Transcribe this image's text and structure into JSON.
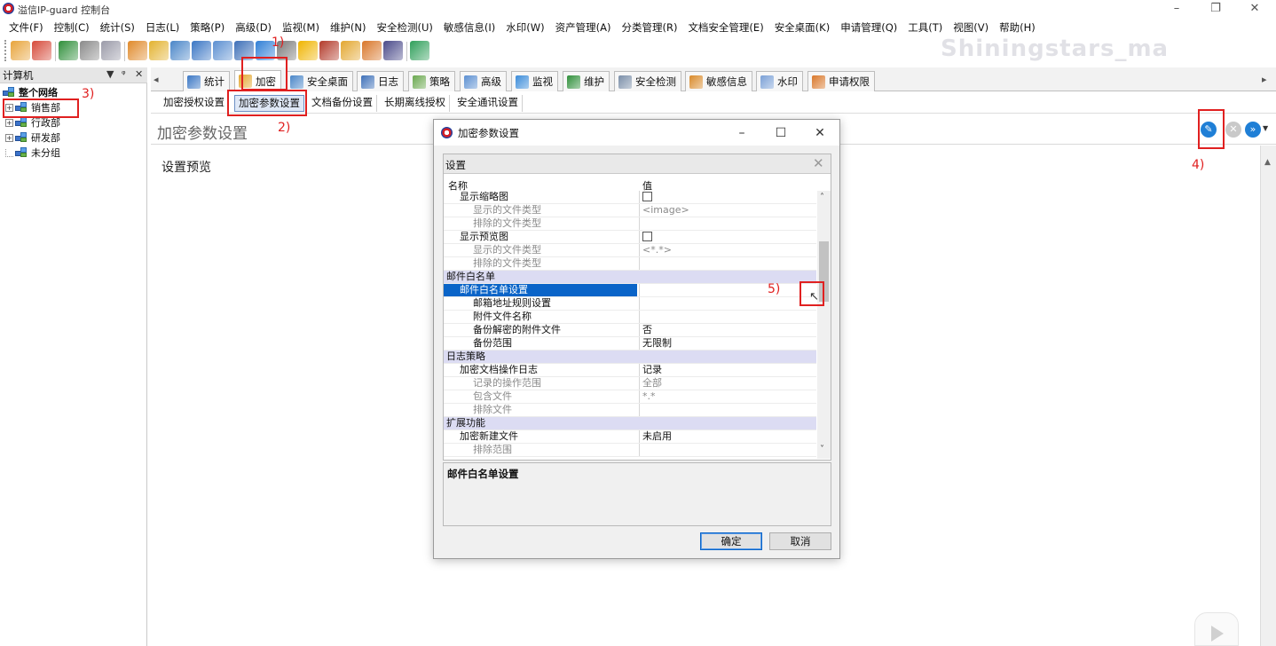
{
  "window": {
    "title": "溢信IP-guard 控制台",
    "controls": {
      "minimize": "–",
      "maximize": "❐",
      "close": "✕"
    }
  },
  "menu": [
    "文件(F)",
    "控制(C)",
    "统计(S)",
    "日志(L)",
    "策略(P)",
    "高级(D)",
    "监视(M)",
    "维护(N)",
    "安全检测(U)",
    "敏感信息(I)",
    "水印(W)",
    "资产管理(A)",
    "分类管理(R)",
    "文档安全管理(E)",
    "安全桌面(K)",
    "申请管理(Q)",
    "工具(T)",
    "视图(V)",
    "帮助(H)"
  ],
  "toolbar_icons": [
    "new-icon",
    "delete-icon",
    "import-icon",
    "print-icon",
    "print-preview-icon",
    "globe-icon",
    "folder-icon",
    "computer-group-icon",
    "monitor-icon",
    "remote-icon",
    "screen-icon",
    "network-icon",
    "disk-icon",
    "warning-icon",
    "book-icon",
    "lock-icon",
    "edit-icon",
    "device-icon",
    "refresh-icon"
  ],
  "watermark": "Shiningstars_ma",
  "left_panel": {
    "title": "计算机",
    "controls": [
      "▼",
      "ᵠ",
      "✕"
    ],
    "tree": [
      {
        "label": "整个网络",
        "level": 0,
        "expander": ""
      },
      {
        "label": "销售部",
        "level": 1,
        "expander": "+"
      },
      {
        "label": "行政部",
        "level": 1,
        "expander": "+"
      },
      {
        "label": "研发部",
        "level": 1,
        "expander": "+"
      },
      {
        "label": "未分组",
        "level": 1,
        "expander": ""
      }
    ]
  },
  "tabs": [
    {
      "label": "统计",
      "icon": "chart-icon",
      "color": "#3a76c4"
    },
    {
      "label": "加密",
      "icon": "lock-icon",
      "color": "#e3a72f"
    },
    {
      "label": "安全桌面",
      "icon": "desktop-icon",
      "color": "#4a86c8"
    },
    {
      "label": "日志",
      "icon": "log-icon",
      "color": "#3d6fb8"
    },
    {
      "label": "策略",
      "icon": "policy-icon",
      "color": "#6aa84f"
    },
    {
      "label": "高级",
      "icon": "advanced-icon",
      "color": "#5b8fd1"
    },
    {
      "label": "监视",
      "icon": "monitor-icon",
      "color": "#3a8bd9"
    },
    {
      "label": "维护",
      "icon": "maintain-icon",
      "color": "#2f8f3a"
    },
    {
      "label": "安全检测",
      "icon": "security-check-icon",
      "color": "#7a8ea8"
    },
    {
      "label": "敏感信息",
      "icon": "sensitive-icon",
      "color": "#d98a2a"
    },
    {
      "label": "水印",
      "icon": "watermark-icon",
      "color": "#7aa0d6"
    },
    {
      "label": "申请权限",
      "icon": "request-icon",
      "color": "#d9772a"
    }
  ],
  "tab_scroll_left": "◂",
  "tab_scroll_right": "▸",
  "subtabs": [
    "加密授权设置",
    "加密参数设置",
    "文档备份设置",
    "长期离线授权",
    "安全通讯设置"
  ],
  "content": {
    "title": "加密参数设置",
    "preview_label": "设置预览"
  },
  "annotations": [
    "1)",
    "2)",
    "3)",
    "4)",
    "5)"
  ],
  "dialog": {
    "title": "加密参数设置",
    "controls": {
      "minimize": "–",
      "maximize": "☐",
      "close": "✕"
    },
    "grid_caption": "设置",
    "grid_close": "✕",
    "columns": {
      "name": "名称",
      "value": "值"
    },
    "rows": [
      {
        "name": "显示缩略图",
        "value": "",
        "checkbox": true,
        "indent": 1,
        "type": "item"
      },
      {
        "name": "显示的文件类型",
        "value": "<image>",
        "indent": 2,
        "type": "dim"
      },
      {
        "name": "排除的文件类型",
        "value": "",
        "indent": 2,
        "type": "dim"
      },
      {
        "name": "显示预览图",
        "value": "",
        "checkbox": true,
        "indent": 1,
        "type": "item"
      },
      {
        "name": "显示的文件类型",
        "value": "<*.*>",
        "indent": 2,
        "type": "dim"
      },
      {
        "name": "排除的文件类型",
        "value": "",
        "indent": 2,
        "type": "dim"
      },
      {
        "name": "邮件白名单",
        "value": "",
        "indent": 0,
        "type": "cat"
      },
      {
        "name": "邮件白名单设置",
        "value": "",
        "indent": 1,
        "type": "sel"
      },
      {
        "name": "邮箱地址规则设置",
        "value": "",
        "indent": 2,
        "type": "item"
      },
      {
        "name": "附件文件名称",
        "value": "",
        "indent": 2,
        "type": "item"
      },
      {
        "name": "备份解密的附件文件",
        "value": "否",
        "indent": 2,
        "type": "item"
      },
      {
        "name": "备份范围",
        "value": "无限制",
        "indent": 2,
        "type": "item"
      },
      {
        "name": "日志策略",
        "value": "",
        "indent": 0,
        "type": "cat"
      },
      {
        "name": "加密文档操作日志",
        "value": "记录",
        "indent": 1,
        "type": "item"
      },
      {
        "name": "记录的操作范围",
        "value": "全部",
        "indent": 2,
        "type": "dim"
      },
      {
        "name": "包含文件",
        "value": "*.*",
        "indent": 2,
        "type": "dim"
      },
      {
        "name": "排除文件",
        "value": "",
        "indent": 2,
        "type": "dim"
      },
      {
        "name": "扩展功能",
        "value": "",
        "indent": 0,
        "type": "cat"
      },
      {
        "name": "加密新建文件",
        "value": "未启用",
        "indent": 1,
        "type": "item"
      },
      {
        "name": "排除范围",
        "value": "",
        "indent": 2,
        "type": "dim"
      }
    ],
    "scroll_up": "˄",
    "scroll_down": "˅",
    "description": "邮件白名单设置",
    "ok_label": "确定",
    "cancel_label": "取消"
  }
}
